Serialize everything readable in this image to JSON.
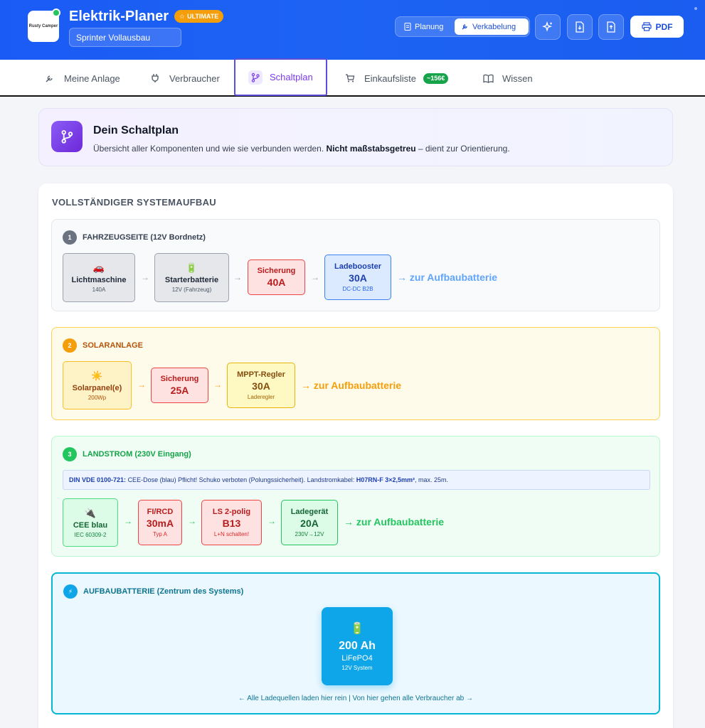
{
  "header": {
    "logo_text": "Rusty Camper",
    "title": "Elektrik-Planer",
    "badge": "ULTIMATE",
    "project_name": "Sprinter Vollausbau",
    "modes": [
      "Planung",
      "Verkabelung"
    ],
    "pdf_label": "PDF"
  },
  "tabs": [
    {
      "label": "Meine Anlage"
    },
    {
      "label": "Verbraucher"
    },
    {
      "label": "Schaltplan"
    },
    {
      "label": "Einkaufsliste",
      "badge": "~156€"
    },
    {
      "label": "Wissen"
    }
  ],
  "intro": {
    "title": "Dein Schaltplan",
    "text_a": "Übersicht aller Komponenten und wie sie verbunden werden.",
    "text_bold": "Nicht maßstabsgetreu",
    "text_b": "– dient zur Orientierung."
  },
  "main_title": "VOLLSTÄNDIGER SYSTEMAUFBAU",
  "sections": {
    "fahrzeug": {
      "num": "1",
      "title": "FAHRZEUGSEITE (12V Bordnetz)",
      "lichtmaschine": {
        "icon": "🚗",
        "name": "Lichtmaschine",
        "sub": "140A"
      },
      "starter": {
        "icon": "🔋",
        "name": "Starterbatterie",
        "sub": "12V (Fahrzeug)"
      },
      "sicherung": {
        "name": "Sicherung",
        "value": "40A"
      },
      "booster": {
        "name": "Ladebooster",
        "value": "30A",
        "sub": "DC-DC B2B"
      },
      "target": "→ zur Aufbaubatterie"
    },
    "solar": {
      "num": "2",
      "title": "SOLARANLAGE",
      "panel": {
        "icon": "☀️",
        "name": "Solarpanel(e)",
        "sub": "200Wp"
      },
      "sicherung": {
        "name": "Sicherung",
        "value": "25A"
      },
      "mppt": {
        "name": "MPPT-Regler",
        "value": "30A",
        "sub": "Laderegler"
      },
      "target": "→ zur Aufbaubatterie"
    },
    "landstrom": {
      "num": "3",
      "title": "LANDSTROM (230V Eingang)",
      "note_bold": "DIN VDE 0100-721:",
      "note_a": "CEE-Dose (blau) Pflicht! Schuko verboten (Polungssicherheit). Landstromkabel:",
      "note_bold2": "H07RN-F 3×2,5mm²",
      "note_b": ", max. 25m.",
      "cee": {
        "icon": "🔌",
        "name": "CEE blau",
        "sub": "IEC 60309-2"
      },
      "fi": {
        "name": "FI/RCD",
        "value": "30mA",
        "sub": "Typ A"
      },
      "ls": {
        "name": "LS 2-polig",
        "value": "B13",
        "sub": "L+N schalten!"
      },
      "lader": {
        "name": "Ladegerät",
        "value": "20A",
        "sub": "230V→12V"
      },
      "target": "→ zur Aufbaubatterie"
    },
    "aufbau": {
      "icon": "⚡",
      "title": "AUFBAUBATTERIE (Zentrum des Systems)",
      "battery": {
        "icon": "🔋",
        "capacity": "200 Ah",
        "chem": "LiFePO4",
        "system": "12V System"
      },
      "caption": "← Alle Ladequellen laden hier rein | Von hier gehen alle Verbraucher ab →"
    }
  },
  "arrow": "→",
  "colors": {
    "header_blue": "#1d63f3",
    "active_tab": "#7c3aed",
    "battery": "#0ea5e9"
  }
}
